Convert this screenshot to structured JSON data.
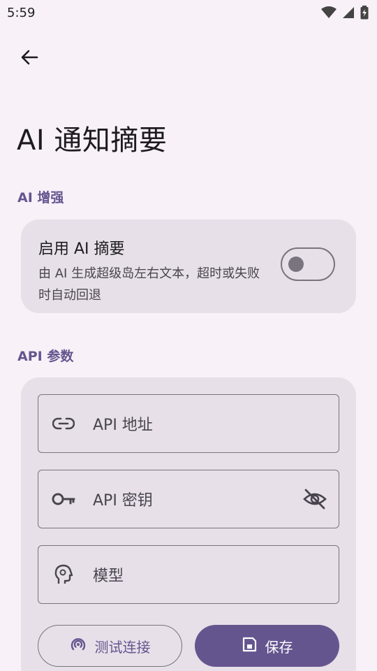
{
  "status_bar": {
    "time": "5:59"
  },
  "header": {
    "title": "AI 通知摘要"
  },
  "ai_section": {
    "header": "AI 增强",
    "toggle": {
      "title": "启用 AI 摘要",
      "description": "由 AI 生成超级岛左右文本，超时或失败时自动回退",
      "enabled": false
    }
  },
  "api_section": {
    "header": "API 参数",
    "fields": {
      "url_placeholder": "API 地址",
      "key_placeholder": "API 密钥",
      "model_placeholder": "模型"
    },
    "buttons": {
      "test_label": "测试连接",
      "save_label": "保存"
    }
  },
  "colors": {
    "accent": "#65558F",
    "background": "#F8F1F8",
    "card": "#E7E0E8",
    "outline": "#79747E"
  }
}
